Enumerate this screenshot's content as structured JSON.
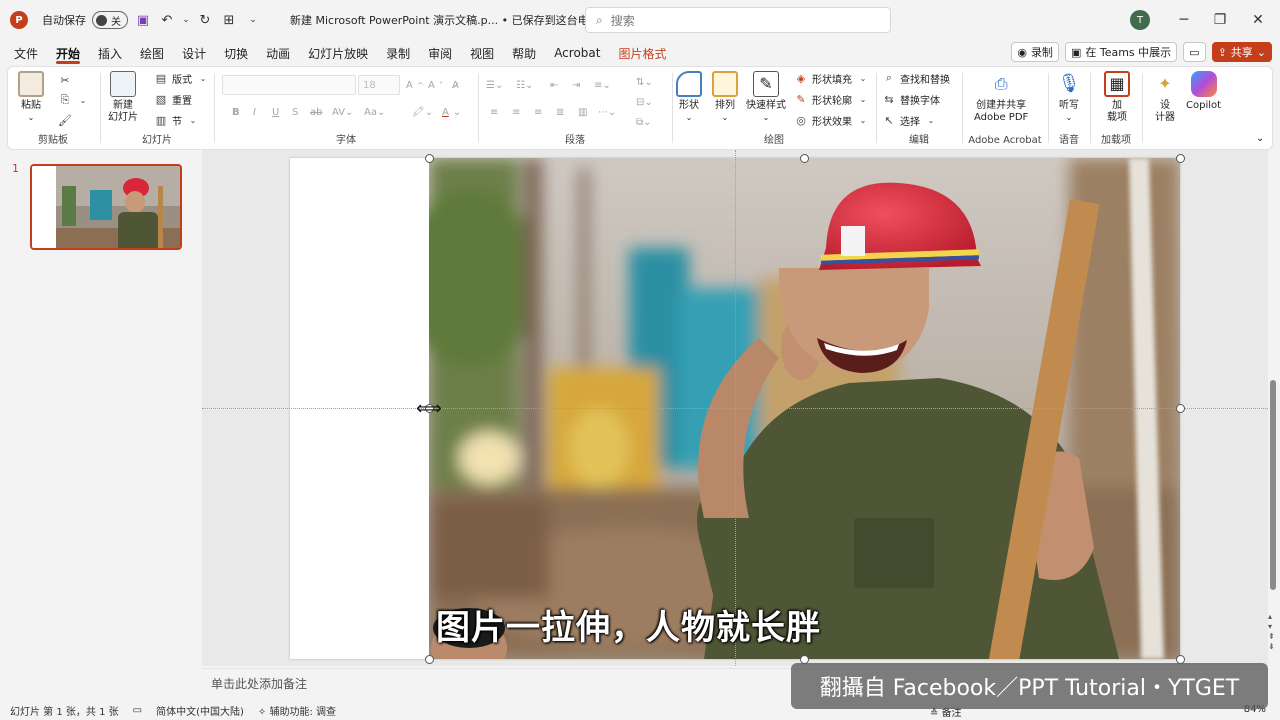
{
  "titlebar": {
    "autosave_label": "自动保存",
    "autosave_state": "关",
    "doc_title": "新建 Microsoft PowerPoint 演示文稿.p...  •  已保存到这台电脑",
    "search_placeholder": "搜索",
    "avatar_initial": "T"
  },
  "tabs": [
    "文件",
    "开始",
    "插入",
    "绘图",
    "设计",
    "切换",
    "动画",
    "幻灯片放映",
    "录制",
    "审阅",
    "视图",
    "帮助",
    "Acrobat",
    "图片格式"
  ],
  "tab_right": {
    "record": "录制",
    "teams": "在 Teams 中展示",
    "share": "共享"
  },
  "ribbon": {
    "clipboard": {
      "paste": "粘贴",
      "label": "剪贴板"
    },
    "slides": {
      "new_slide": "新建\n幻灯片",
      "layout": "版式",
      "reset": "重置",
      "section": "节",
      "label": "幻灯片"
    },
    "font": {
      "size": "18",
      "label": "字体"
    },
    "paragraph": {
      "label": "段落"
    },
    "drawing": {
      "shapes": "形状",
      "arrange": "排列",
      "quick_styles": "快速样式",
      "fill": "形状填充",
      "outline": "形状轮廓",
      "effects": "形状效果",
      "label": "绘图"
    },
    "editing": {
      "find": "查找和替换",
      "replace": "替换字体",
      "select": "选择",
      "label": "编辑"
    },
    "acrobat": {
      "create": "创建并共享\nAdobe PDF",
      "label": "Adobe Acrobat"
    },
    "voice": {
      "dictate": "听写",
      "label": "语音"
    },
    "addins": {
      "addins": "加\n载项",
      "label": "加载项"
    },
    "designer": {
      "designer": "设\n计器"
    },
    "copilot": {
      "copilot": "Copilot"
    }
  },
  "slide_panel": {
    "slide_number": "1"
  },
  "canvas": {
    "subtitle": "图片一拉伸，人物就长胖"
  },
  "notes": {
    "placeholder": "单击此处添加备注"
  },
  "status": {
    "slide_info": "幻灯片 第 1 张，共 1 张",
    "language": "简体中文(中国大陆)",
    "accessibility": "辅助功能: 调查",
    "notes_btn": "备注",
    "zoom": "84%"
  },
  "watermark": "翻攝自 Facebook／PPT Tutorial・YTGET",
  "colors": {
    "accent": "#c43e1c",
    "helmet": "#d8263a",
    "shirt": "#4e5636"
  }
}
